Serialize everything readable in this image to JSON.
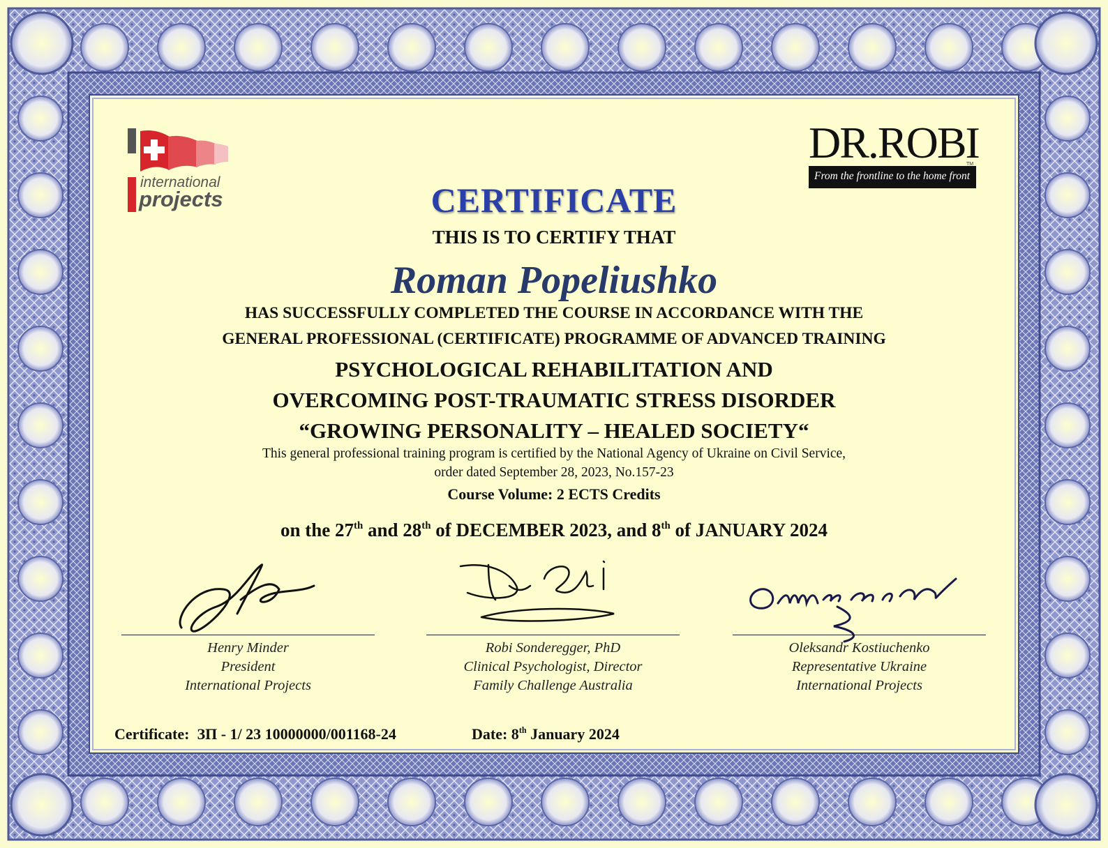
{
  "logos": {
    "left": {
      "text_top": "international",
      "text_bottom": "projects",
      "accent": "#d6262b"
    },
    "right": {
      "brand": "DR.ROBI",
      "tagline": "From the frontline to the home front",
      "tm": "TM"
    }
  },
  "title": "CERTIFICATE",
  "certify_line": "THIS IS TO CERTIFY THAT",
  "recipient_name": "Roman Popeliushko",
  "completion": {
    "line1": "HAS SUCCESSFULLY COMPLETED THE COURSE IN ACCORDANCE WITH THE",
    "line2": "GENERAL PROFESSIONAL (CERTIFICATE) PROGRAMME OF ADVANCED TRAINING"
  },
  "course": {
    "line1": "PSYCHOLOGICAL REHABILITATION AND",
    "line2": "OVERCOMING POST-TRAUMATIC STRESS DISORDER",
    "line3": "“GROWING PERSONALITY – HEALED SOCIETY“"
  },
  "accreditation": {
    "line1": "This general professional training program is certified by the National Agency of Ukraine on Civil Service,",
    "line2": "order dated September 28, 2023, No.157-23"
  },
  "course_volume": "Course Volume: 2 ECTS Credits",
  "dates": {
    "p1": "on the 27",
    "s1": "th",
    "p2": " and 28",
    "s2": "th",
    "p3": " of DECEMBER 2023, and 8",
    "s3": "th",
    "p4": " of JANUARY 2024"
  },
  "signatories": [
    {
      "name": "Henry Minder",
      "role": "President",
      "org": "International Projects"
    },
    {
      "name": "Robi Sonderegger, PhD",
      "role": "Clinical Psychologist, Director",
      "org": "Family Challenge Australia"
    },
    {
      "name": "Oleksandr Kostiuchenko",
      "role": "Representative Ukraine",
      "org": "International Projects"
    }
  ],
  "footer": {
    "certificate_label": "Certificate:",
    "certificate_number": "ЗП - 1/ 23 10000000/001168-24",
    "date_label": "Date: 8",
    "date_sup": "th",
    "date_rest": " January 2024"
  },
  "colors": {
    "border": "#7d86c0",
    "border_dark": "#4e5a9a",
    "background": "#fdfdcf",
    "title": "#2b3fa8",
    "name": "#273a6b"
  }
}
